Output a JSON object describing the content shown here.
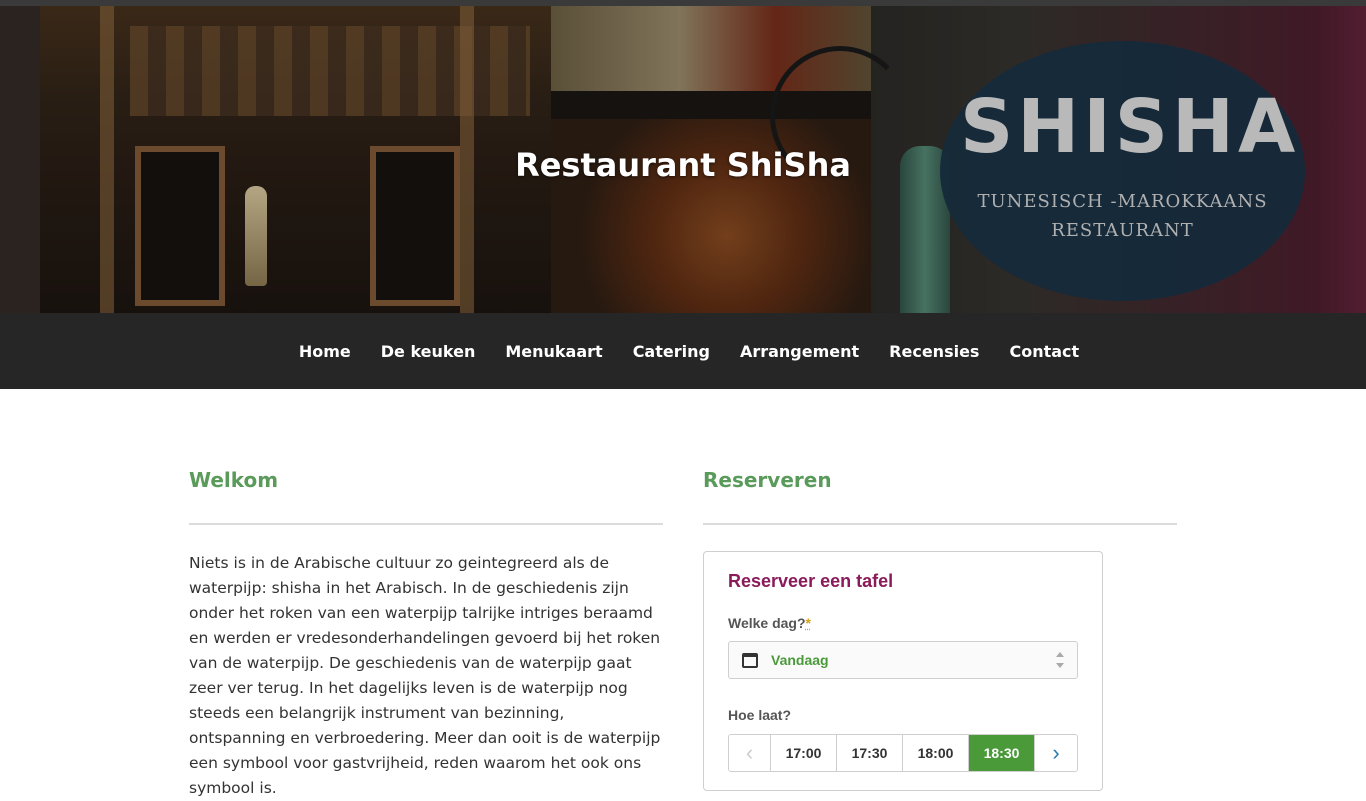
{
  "site": {
    "title": "Restaurant ShiSha"
  },
  "hero": {
    "logo_word": "SHISHA",
    "logo_sub1": "TUNESISCH -MAROKKAANS",
    "logo_sub2": "RESTAURANT"
  },
  "nav": {
    "items": [
      "Home",
      "De keuken",
      "Menukaart",
      "Catering",
      "Arrangement",
      "Recensies",
      "Contact"
    ]
  },
  "welkom": {
    "title": "Welkom",
    "text": "Niets is in de Arabische cultuur zo geintegreerd als de waterpijp: shisha in het Arabisch. In de geschiedenis zijn onder het roken van een waterpijp talrijke intriges beraamd en werden er vredesonderhandelingen gevoerd bij het roken van de waterpijp. De geschiedenis van de waterpijp gaat zeer ver terug. In het dagelijks leven is de waterpijp nog steeds een belangrijk instrument van bezinning, ontspanning en verbroedering. Meer dan ooit is de waterpijp een symbool voor gastvrijheid, reden waarom het ook ons symbool is."
  },
  "reserveren": {
    "title": "Reserveren",
    "widget_title": "Reserveer een tafel",
    "day_label": "Welke dag?",
    "required_mark": "*",
    "day_value": "Vandaag",
    "time_label": "Hoe laat?",
    "times": [
      "17:00",
      "17:30",
      "18:00",
      "18:30"
    ],
    "selected_time": "18:30",
    "prev_icon": "‹",
    "next_icon": "›"
  },
  "colors": {
    "accent_green": "#5a9a5a",
    "selected_green": "#4a9a3a",
    "widget_title": "#8a1a5a",
    "nav_bg": "#262626"
  }
}
